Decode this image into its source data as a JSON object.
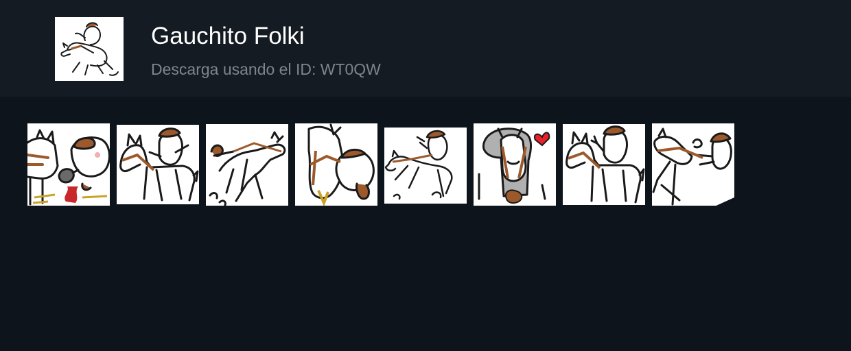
{
  "pack": {
    "title": "Gauchito Folki",
    "subtitle": "Descarga usando el ID: WT0QW",
    "icon": "gaucho-riding-horse-icon"
  },
  "colors": {
    "page_background": "#0d141b",
    "header_background": "#141b22",
    "title": "#ffffff",
    "subtitle": "#7e858d",
    "sticker_background": "#ffffff",
    "outline": "#1a1a1a",
    "beret_brown": "#9c5a2c",
    "heart_red": "#e8202a",
    "fire_red": "#c8282a"
  },
  "stickers": [
    {
      "icon": "gaucho-mate-kettle-horse-sticker"
    },
    {
      "icon": "gaucho-riding-horse-sticker"
    },
    {
      "icon": "rearing-horse-sticker"
    },
    {
      "icon": "horses-drinking-mate-sticker"
    },
    {
      "icon": "gaucho-galloping-sticker"
    },
    {
      "icon": "horse-with-heart-sticker"
    },
    {
      "icon": "gaucho-waving-on-horse-sticker"
    },
    {
      "icon": "gaucho-pulling-horse-sticker"
    }
  ]
}
